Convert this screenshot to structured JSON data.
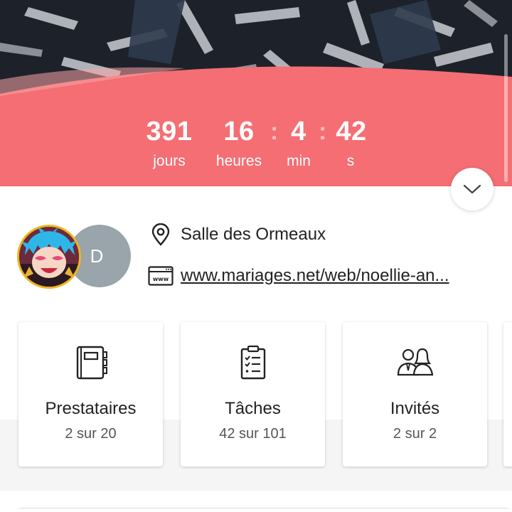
{
  "colors": {
    "accent": "#f46e73",
    "text": "#222222",
    "muted": "#555555",
    "avatar_gray": "#99a4ab"
  },
  "countdown": {
    "days": {
      "value": "391",
      "label": "jours"
    },
    "hours": {
      "value": "16",
      "label": "heures"
    },
    "minutes": {
      "value": "4",
      "label": "min"
    },
    "seconds": {
      "value": "42",
      "label": "s"
    },
    "separator": ":"
  },
  "toggle": {
    "icon": "chevron-down-icon"
  },
  "couple": {
    "partner_initial": "D",
    "user_avatar": "anime-character-avatar"
  },
  "info": {
    "venue": {
      "icon": "location-pin-icon",
      "text": "Salle des Ormeaux"
    },
    "website": {
      "icon": "www-icon",
      "text": "www.mariages.net/web/noellie-an..."
    }
  },
  "cards": [
    {
      "icon": "notebook-icon",
      "title": "Prestataires",
      "subtitle": "2 sur 20"
    },
    {
      "icon": "checklist-icon",
      "title": "Tâches",
      "subtitle": "42 sur 101"
    },
    {
      "icon": "guests-icon",
      "title": "Invités",
      "subtitle": "2 sur 2"
    }
  ]
}
